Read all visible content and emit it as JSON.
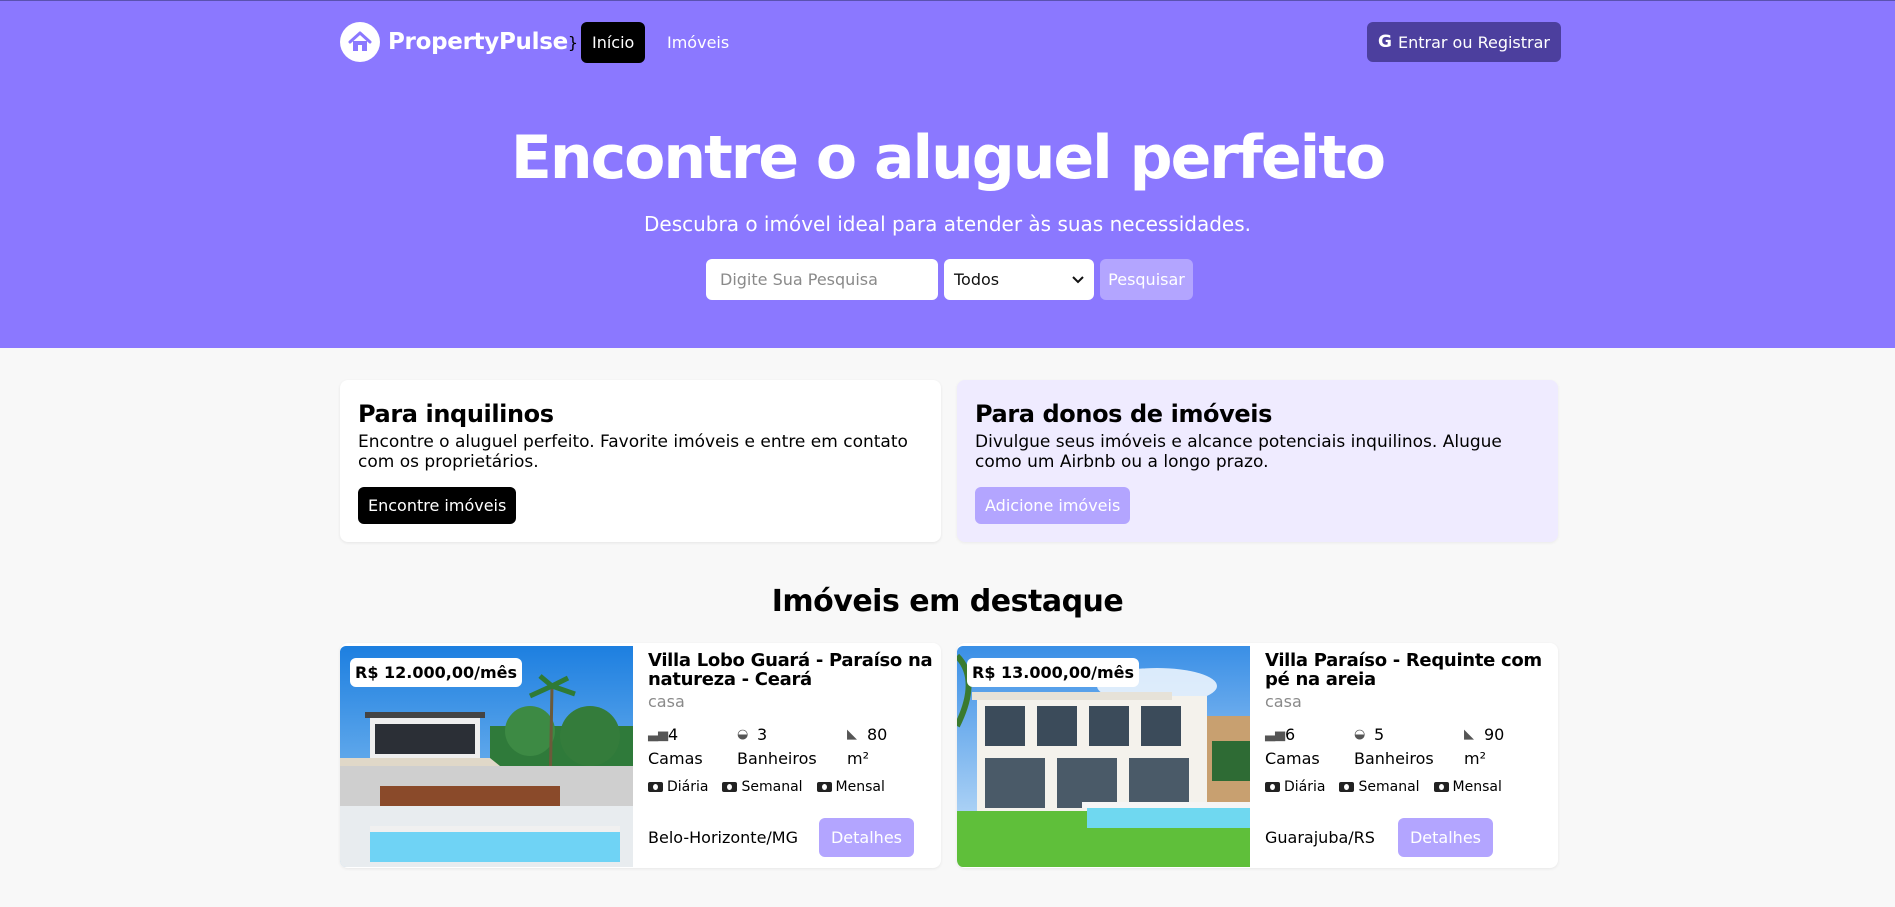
{
  "header": {
    "brand": "PropertyPulse",
    "nav": [
      {
        "label": "Início"
      },
      {
        "label": "Imóveis"
      }
    ],
    "login_label": "Entrar ou Registrar"
  },
  "hero": {
    "title": "Encontre o aluguel perfeito",
    "subtitle": "Descubra o imóvel ideal para atender às suas necessidades.",
    "search_placeholder": "Digite Sua Pesquisa",
    "select_value": "Todos",
    "search_button": "Pesquisar"
  },
  "info_cards": [
    {
      "title": "Para inquilinos",
      "text": "Encontre o aluguel perfeito. Favorite imóveis e entre em contato com os proprietários.",
      "button": "Encontre imóveis"
    },
    {
      "title": "Para donos de imóveis",
      "text": "Divulgue seus imóveis e alcance potenciais inquilinos. Alugue como um Airbnb ou a longo prazo.",
      "button": "Adicione imóveis"
    }
  ],
  "featured": {
    "title": "Imóveis em destaque",
    "properties": [
      {
        "price": "R$ 12.000,00/mês",
        "title": "Villa Lobo Guará - Paraíso na natureza - Ceará",
        "type": "casa",
        "beds": "4",
        "beds_label": "Camas",
        "baths": "3",
        "baths_label": "Banheiros",
        "area": "80",
        "area_label": "m²",
        "rates": [
          "Diária",
          "Semanal",
          "Mensal"
        ],
        "location": "Belo-Horizonte/MG",
        "button": "Detalhes"
      },
      {
        "price": "R$ 13.000,00/mês",
        "title": "Villa Paraíso - Requinte com pé na areia",
        "type": "casa",
        "beds": "6",
        "beds_label": "Camas",
        "baths": "5",
        "baths_label": "Banheiros",
        "area": "90",
        "area_label": "m²",
        "rates": [
          "Diária",
          "Semanal",
          "Mensal"
        ],
        "location": "Guarajuba/RS",
        "button": "Detalhes"
      }
    ]
  },
  "colors": {
    "hero_bg": "#8b78ff",
    "login_bg": "#4c3f9e",
    "accent_light": "#b3a5ff",
    "owners_card_bg": "#efebff"
  }
}
